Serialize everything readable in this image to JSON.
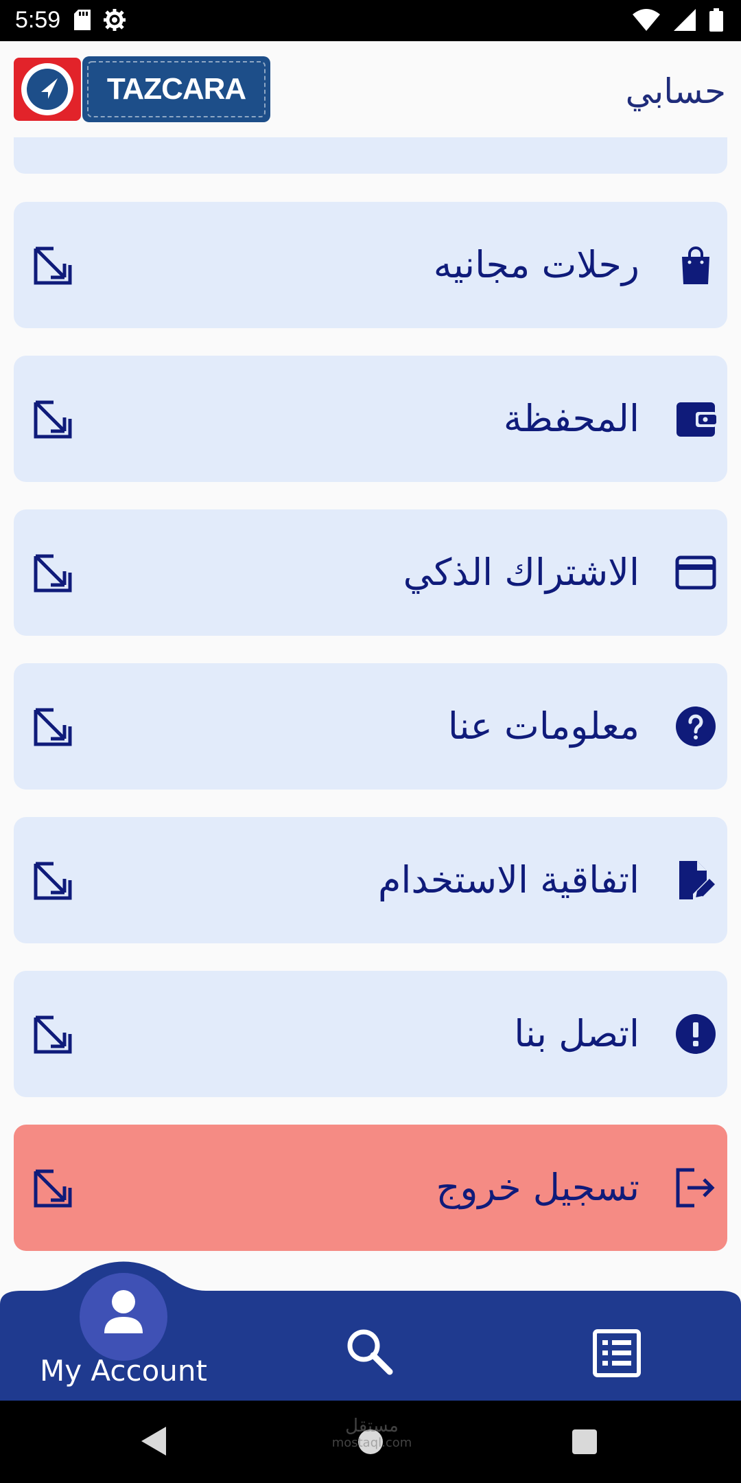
{
  "status_bar": {
    "time": "5:59",
    "left_icons": [
      "sd-card-icon",
      "settings-gear-icon"
    ],
    "right_icons": [
      "wifi-icon",
      "signal-icon",
      "battery-icon"
    ]
  },
  "header": {
    "logo_text": "TAZCARA",
    "title": "حسابي"
  },
  "menu": {
    "items": [
      {
        "label": "رحلات مجانيه",
        "icon": "shopping-bag-icon"
      },
      {
        "label": "المحفظة",
        "icon": "wallet-icon"
      },
      {
        "label": "الاشتراك الذكي",
        "icon": "credit-card-icon"
      },
      {
        "label": "معلومات عنا",
        "icon": "help-circle-icon"
      },
      {
        "label": "اتفاقية الاستخدام",
        "icon": "document-edit-icon"
      },
      {
        "label": "اتصل بنا",
        "icon": "alert-circle-icon"
      }
    ],
    "logout": {
      "label": "تسجيل خروج",
      "icon": "logout-icon"
    }
  },
  "bottom_nav": {
    "account_label": "My Account",
    "items": [
      "account-icon",
      "search-icon",
      "list-icon"
    ]
  },
  "system_nav": {
    "watermark": "مستقل",
    "watermark_sub": "mostaql.com"
  },
  "colors": {
    "card": "#e2ebfa",
    "logout_card": "#f58b84",
    "text": "#0f1b7a",
    "nav": "#1f3a8f",
    "logo_red": "#e2232a",
    "logo_blue": "#1d4e89"
  }
}
